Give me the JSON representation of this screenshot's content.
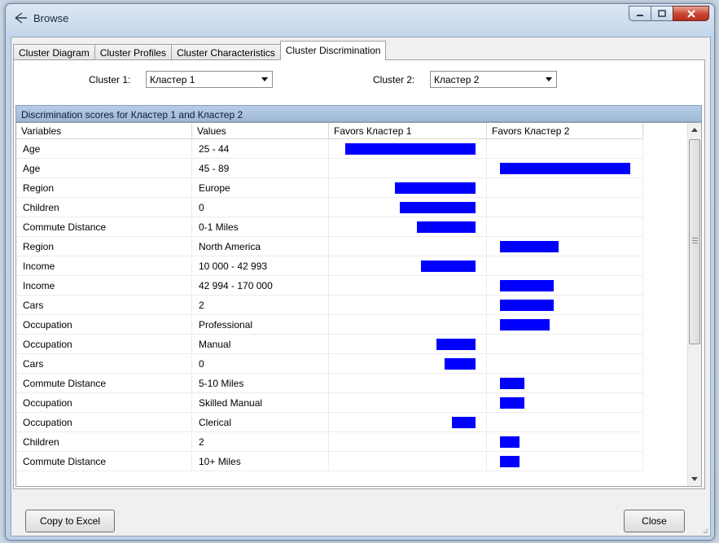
{
  "window": {
    "title": "Browse"
  },
  "tabs": [
    {
      "label": "Cluster Diagram",
      "active": false
    },
    {
      "label": "Cluster Profiles",
      "active": false
    },
    {
      "label": "Cluster Characteristics",
      "active": false
    },
    {
      "label": "Cluster Discrimination",
      "active": true
    }
  ],
  "selectors": {
    "cluster1_label": "Cluster 1:",
    "cluster1_value": "Кластер 1",
    "cluster2_label": "Cluster 2:",
    "cluster2_value": "Кластер 2"
  },
  "grid": {
    "title": "Discrimination scores for Кластер 1 and Кластер 2",
    "columns": [
      "Variables",
      "Values",
      "Favors Кластер 1",
      "Favors Кластер 2"
    ],
    "rows": [
      {
        "variable": "Age",
        "value": "25 - 44",
        "favors": "1",
        "score": 100
      },
      {
        "variable": "Age",
        "value": "45 - 89",
        "favors": "2",
        "score": 100
      },
      {
        "variable": "Region",
        "value": "Europe",
        "favors": "1",
        "score": 62
      },
      {
        "variable": "Children",
        "value": "0",
        "favors": "1",
        "score": 58
      },
      {
        "variable": "Commute Distance",
        "value": "0-1 Miles",
        "favors": "1",
        "score": 45
      },
      {
        "variable": "Region",
        "value": "North America",
        "favors": "2",
        "score": 45
      },
      {
        "variable": "Income",
        "value": "10 000 - 42 993",
        "favors": "1",
        "score": 42
      },
      {
        "variable": "Income",
        "value": "42 994 - 170 000",
        "favors": "2",
        "score": 41
      },
      {
        "variable": "Cars",
        "value": "2",
        "favors": "2",
        "score": 41
      },
      {
        "variable": "Occupation",
        "value": "Professional",
        "favors": "2",
        "score": 38
      },
      {
        "variable": "Occupation",
        "value": "Manual",
        "favors": "1",
        "score": 30
      },
      {
        "variable": "Cars",
        "value": "0",
        "favors": "1",
        "score": 24
      },
      {
        "variable": "Commute Distance",
        "value": "5-10 Miles",
        "favors": "2",
        "score": 19
      },
      {
        "variable": "Occupation",
        "value": "Skilled Manual",
        "favors": "2",
        "score": 19
      },
      {
        "variable": "Occupation",
        "value": "Clerical",
        "favors": "1",
        "score": 18
      },
      {
        "variable": "Children",
        "value": "2",
        "favors": "2",
        "score": 15
      },
      {
        "variable": "Commute Distance",
        "value": "10+ Miles",
        "favors": "2",
        "score": 15
      }
    ]
  },
  "footer": {
    "copy_label": "Copy to Excel",
    "close_label": "Close"
  },
  "colors": {
    "bar": "#0000ff",
    "header_band": "#a9c1de"
  }
}
